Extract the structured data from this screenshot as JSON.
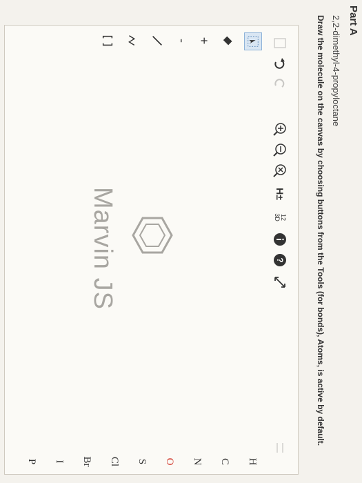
{
  "part": {
    "title": "Part A"
  },
  "question": {
    "compound": "2,2-dimethyl-4-propyloctane",
    "instructions": "Draw the molecule on the canvas by choosing buttons from the Tools (for bonds), Atoms, is active by default."
  },
  "toolbar": {
    "hydrogen_toggle": "H±",
    "numbering": "12\n3D",
    "help": "?"
  },
  "atoms": [
    "H",
    "C",
    "N",
    "O",
    "S",
    "Cl",
    "Br",
    "I",
    "P"
  ],
  "canvas": {
    "brand": "Marvin JS"
  },
  "colors": {
    "oxygen": "#d23a2e",
    "accent": "#8fb3d9",
    "muted": "#a8a6a1"
  }
}
